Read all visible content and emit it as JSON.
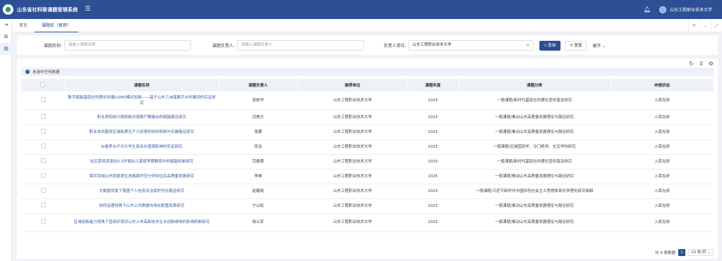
{
  "header": {
    "app_title": "山东省社科联课题管理系统",
    "menu_icon": "menu-toggle-icon",
    "user_name": "山东工程职业技术大学"
  },
  "sidebar": {
    "items": [
      "home-icon",
      "grid-icon",
      "document-icon"
    ]
  },
  "tabs": [
    {
      "label": "首页"
    },
    {
      "label": "课题库（推荐）"
    }
  ],
  "search": {
    "name_label": "课题名称:",
    "name_placeholder": "请输入课题名称",
    "leader_label": "课题负责人:",
    "leader_placeholder": "请输入课题负责人",
    "unit_label": "负责人单位:",
    "unit_value": "山东工程职业技术大学",
    "query_button": "查询",
    "reset_button": "重置",
    "expand_label": "展开"
  },
  "alert": {
    "text": "未选中任何数据"
  },
  "table": {
    "headers": [
      "课题名称",
      "课题负责人",
      "推荐单位",
      "课题年度",
      "课题分类",
      "申报状态"
    ],
    "rows": [
      {
        "name": "数字赋能基层社科理论传播O2MO模式创新——基于山东三洲溪数字乡村建设的实证研究",
        "leader": "张栋华",
        "unit": "山东工程职业技术大学",
        "year": "2025",
        "category": "一般课题/新时代基层社科理论宣传普及研究",
        "status": "入库在研"
      },
      {
        "name": "职业类院校行政机制对易数产教融合的赋能路径研究",
        "leader": "闫美方",
        "unit": "山东工程职业技术大学",
        "year": "2025",
        "category": "一般课题/推动山东高质量发展理论与路径研究",
        "status": "入库在研"
      },
      {
        "name": "职业本科服务区域新质生产力培育的协同机制与实施路径研究",
        "leader": "张娜",
        "unit": "山东工程职业技术大学",
        "year": "2025",
        "category": "一般课题/推动山东高质量发展理论与路径研究",
        "status": "入库在研"
      },
      {
        "name": "AI素养水平对大学生就业价值观影响的实证研究",
        "leader": "宋洁",
        "unit": "山东工程职业技术大学",
        "year": "2025",
        "category": "一般课题/区域国别学、冷门绝学、交叉学科研究",
        "status": "入库在研"
      },
      {
        "name": "社区菜育资源在0-3岁婴幼儿家庭早期教育中的赋能机制研究",
        "leader": "范春蓉",
        "unit": "山东工程职业技术大学",
        "year": "2025",
        "category": "一般课题/新时代基层社科理论宣传普及研究",
        "status": "入库在研"
      },
      {
        "name": "黄河流域山东段景观生态格局时空分异特征及高质量发展研究",
        "leader": "李琳",
        "unit": "山东工程职业技术大学",
        "year": "2025",
        "category": "一般课题/推动山东高质量发展理论与路径研究",
        "status": "入库在研"
      },
      {
        "name": "大数据背景下我国个人信息法治保护优化路径研究",
        "leader": "赵馥晓",
        "unit": "山东工程职业技术大学",
        "year": "2025",
        "category": "一般课题/习近平新时代中国特色社会主义思想体系化学理化研究阐释",
        "status": "入库在研"
      },
      {
        "name": "协同治理视角下山东公共数据市场化配置改革研究",
        "leader": "宁山松",
        "unit": "山东工程职业技术大学",
        "year": "2025",
        "category": "一般课题/推动山东高质量发展理论与路径研究",
        "status": "入库在研"
      },
      {
        "name": "区域创新能力视角下营商环境对山东上市高新技术企业创新绩效的影响机制研究",
        "leader": "徐以军",
        "unit": "山东工程职业技术大学",
        "year": "2025",
        "category": "一般课题/推动山东高质量发展理论与路径研究",
        "status": "入库在研"
      }
    ]
  },
  "pagination": {
    "total": "共 9 条数据",
    "page": "1",
    "page_size": "10 条/页"
  }
}
